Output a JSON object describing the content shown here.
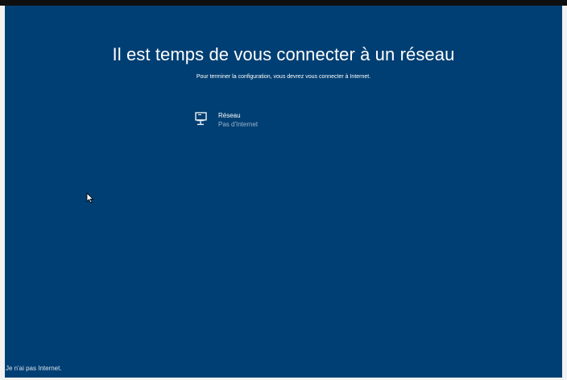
{
  "setup": {
    "title": "Il est temps de vous connecter à un réseau",
    "subtitle": "Pour terminer la configuration, vous devrez vous connecter à Internet."
  },
  "network": {
    "name": "Réseau",
    "status": "Pas d'Internet",
    "icon": "network-pc-icon"
  },
  "footer": {
    "no_internet_label": "Je n'ai pas Internet."
  },
  "colors": {
    "background": "#003f73",
    "text": "#ffffff",
    "muted_text": "#9fb6cf"
  }
}
